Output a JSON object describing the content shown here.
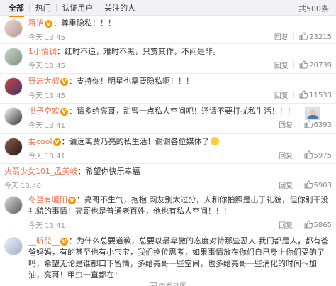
{
  "tabs": [
    {
      "label": "全部"
    },
    {
      "label": "热门"
    },
    {
      "label": "认证用户"
    },
    {
      "label": "关注的人"
    }
  ],
  "total_count": "共500条",
  "actions": {
    "reply": "回复"
  },
  "comments": [
    {
      "user": "蒋洁",
      "verified": true,
      "text": "：尊重隐私！！！",
      "time": "今天 13:45",
      "likes": "23215"
    },
    {
      "user": "1小情调",
      "verified": false,
      "text": "：红时不追，难时不黑，只赏其作，不问是非。",
      "time": "今天 13:45",
      "likes": "20739"
    },
    {
      "user": "野志大叔",
      "verified": true,
      "text": "：支持你！明星也需要隐私啊！！！",
      "time": "今天 13:45",
      "likes": "11533"
    },
    {
      "user": "书予空欢",
      "verified": true,
      "text": "：请多给亮哥，甜蜜一点私人空间吧！还请不要打扰私生活！！！",
      "time": "今天 13:41",
      "likes": "6393"
    },
    {
      "user": "要cool",
      "verified": true,
      "text": "：请远离贾乃亮的私生活！谢谢各位媒体了",
      "time": "今天 13:41",
      "likes": "5975"
    },
    {
      "user": "火箭少女101_孟美岐",
      "verified": false,
      "text": "：希望你快乐幸福",
      "time": "今天 13:40",
      "likes": "5903"
    },
    {
      "user": "冬至有暖阳",
      "verified": true,
      "text": "：亮哥不生气，抱抱 网友别太过分，人和你拍照是出于礼貌，但你别干没礼貌的事情！亮哥也是普通老百姓，他也有私人空间！！！",
      "time": "今天 13:41",
      "likes": "5865"
    },
    {
      "user": "__昕兒__",
      "verified": true,
      "text": "：为什么总要道歉，总要以最卑微的态度对待那些恶人,我们都是人，都有爸爸妈妈，有的甚至也有小宝宝，我们换位思考，如果事情放在你们自己身上你们受的了吗，希望无论是谁都口下留情，多给亮哥一些空间，也多给亮哥一些消化的时间～加油，亮哥！甲虫一直都在！",
      "time": "",
      "likes": ""
    }
  ],
  "expand_text": "查看动图",
  "colors": {
    "username": "#eb7350",
    "accent": "#ff8200",
    "badge": "#f39800"
  }
}
